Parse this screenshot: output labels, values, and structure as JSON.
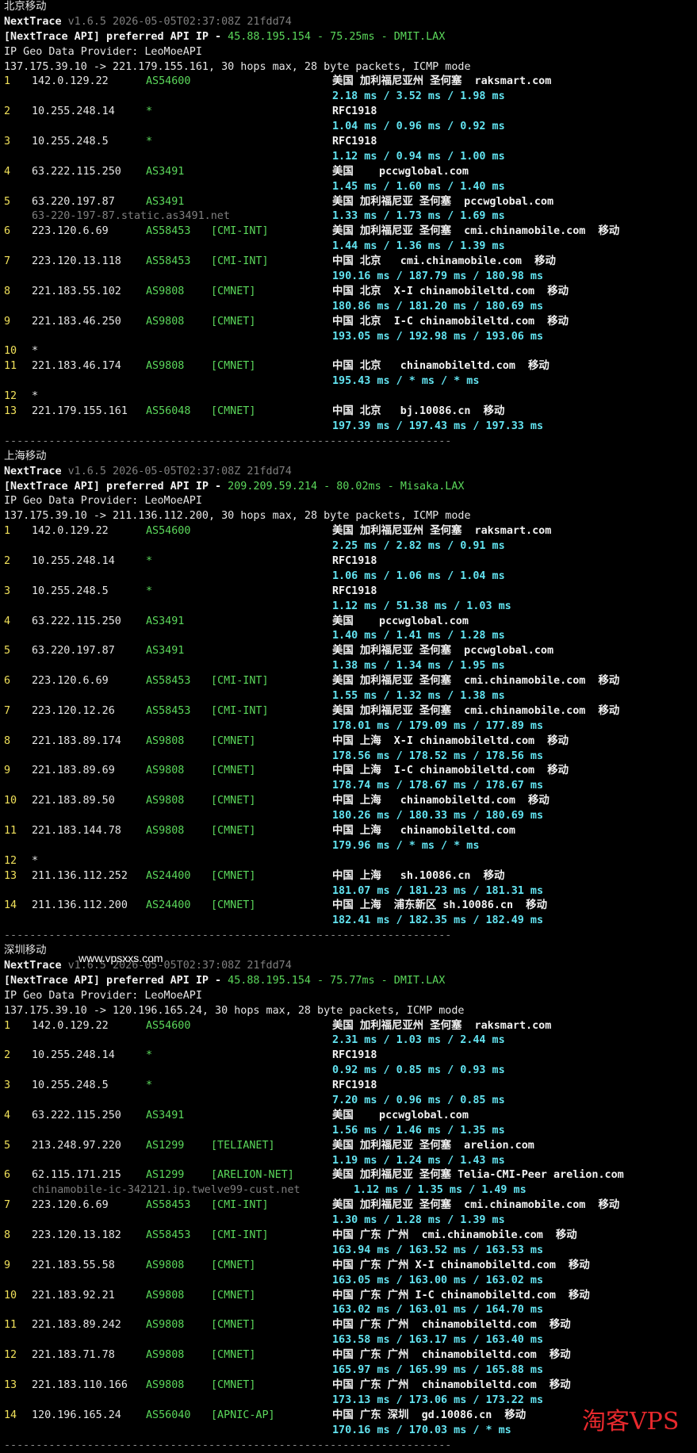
{
  "watermark_site": "www.vpsxxs.com",
  "watermark_logo": "淘客VPS",
  "separator": "----------------------------------------------------------------------",
  "sections": [
    {
      "title": "北京移动",
      "app": "NextTrace",
      "version": "v1.6.5 2026-05-05T02:37:08Z 21fdd74",
      "api_prefix": "[NextTrace API] preferred API IP - ",
      "api_ip": "45.88.195.154",
      "api_latency": "75.25ms",
      "api_node": "DMIT.LAX",
      "geo": "IP Geo Data Provider: LeoMoeAPI",
      "trace": "137.175.39.10 -> 221.179.155.161, 30 hops max, 28 byte packets, ICMP mode",
      "hops": [
        {
          "n": "1",
          "ip": "142.0.129.22",
          "as": "AS54600",
          "tag": "",
          "geo": "美国 加利福尼亚州 圣何塞  raksmart.com",
          "rtt": "2.18 ms / 3.52 ms / 1.98 ms"
        },
        {
          "n": "2",
          "ip": "10.255.248.14",
          "as": "*",
          "tag": "",
          "geo": "RFC1918",
          "rtt": "1.04 ms / 0.96 ms / 0.92 ms"
        },
        {
          "n": "3",
          "ip": "10.255.248.5",
          "as": "*",
          "tag": "",
          "geo": "RFC1918",
          "rtt": "1.12 ms / 0.94 ms / 1.00 ms"
        },
        {
          "n": "4",
          "ip": "63.222.115.250",
          "as": "AS3491",
          "tag": "",
          "geo": "美国    pccwglobal.com",
          "rtt": "1.45 ms / 1.60 ms / 1.40 ms"
        },
        {
          "n": "5",
          "ip": "63.220.197.87",
          "as": "AS3491",
          "tag": "",
          "geo": "美国 加利福尼亚 圣何塞  pccwglobal.com",
          "rtt": "1.33 ms / 1.73 ms / 1.69 ms",
          "rdns": "63-220-197-87.static.as3491.net"
        },
        {
          "n": "6",
          "ip": "223.120.6.69",
          "as": "AS58453",
          "tag": "[CMI-INT]",
          "geo": "美国 加利福尼亚 圣何塞  cmi.chinamobile.com  移动",
          "rtt": "1.44 ms / 1.36 ms / 1.39 ms"
        },
        {
          "n": "7",
          "ip": "223.120.13.118",
          "as": "AS58453",
          "tag": "[CMI-INT]",
          "geo": "中国 北京   cmi.chinamobile.com  移动",
          "rtt": "190.16 ms / 187.79 ms / 180.98 ms"
        },
        {
          "n": "8",
          "ip": "221.183.55.102",
          "as": "AS9808",
          "tag": "[CMNET]",
          "geo": "中国 北京  X-I chinamobileltd.com  移动",
          "rtt": "180.86 ms / 181.20 ms / 180.69 ms"
        },
        {
          "n": "9",
          "ip": "221.183.46.250",
          "as": "AS9808",
          "tag": "[CMNET]",
          "geo": "中国 北京  I-C chinamobileltd.com  移动",
          "rtt": "193.05 ms / 192.98 ms / 193.06 ms"
        },
        {
          "n": "10",
          "ip": "*"
        },
        {
          "n": "11",
          "ip": "221.183.46.174",
          "as": "AS9808",
          "tag": "[CMNET]",
          "geo": "中国 北京   chinamobileltd.com  移动",
          "rtt": "195.43 ms / * ms / * ms"
        },
        {
          "n": "12",
          "ip": "*"
        },
        {
          "n": "13",
          "ip": "221.179.155.161",
          "as": "AS56048",
          "tag": "[CMNET]",
          "geo": "中国 北京   bj.10086.cn  移动",
          "rtt": "197.39 ms / 197.43 ms / 197.33 ms"
        }
      ]
    },
    {
      "title": "上海移动",
      "app": "NextTrace",
      "version": "v1.6.5 2026-05-05T02:37:08Z 21fdd74",
      "api_prefix": "[NextTrace API] preferred API IP - ",
      "api_ip": "209.209.59.214",
      "api_latency": "80.02ms",
      "api_node": "Misaka.LAX",
      "geo": "IP Geo Data Provider: LeoMoeAPI",
      "trace": "137.175.39.10 -> 211.136.112.200, 30 hops max, 28 byte packets, ICMP mode",
      "hops": [
        {
          "n": "1",
          "ip": "142.0.129.22",
          "as": "AS54600",
          "tag": "",
          "geo": "美国 加利福尼亚州 圣何塞  raksmart.com",
          "rtt": "2.25 ms / 2.82 ms / 0.91 ms"
        },
        {
          "n": "2",
          "ip": "10.255.248.14",
          "as": "*",
          "tag": "",
          "geo": "RFC1918",
          "rtt": "1.06 ms / 1.06 ms / 1.04 ms"
        },
        {
          "n": "3",
          "ip": "10.255.248.5",
          "as": "*",
          "tag": "",
          "geo": "RFC1918",
          "rtt": "1.12 ms / 51.38 ms / 1.03 ms"
        },
        {
          "n": "4",
          "ip": "63.222.115.250",
          "as": "AS3491",
          "tag": "",
          "geo": "美国    pccwglobal.com",
          "rtt": "1.40 ms / 1.41 ms / 1.28 ms"
        },
        {
          "n": "5",
          "ip": "63.220.197.87",
          "as": "AS3491",
          "tag": "",
          "geo": "美国 加利福尼亚 圣何塞  pccwglobal.com",
          "rtt": "1.38 ms / 1.34 ms / 1.95 ms"
        },
        {
          "n": "6",
          "ip": "223.120.6.69",
          "as": "AS58453",
          "tag": "[CMI-INT]",
          "geo": "美国 加利福尼亚 圣何塞  cmi.chinamobile.com  移动",
          "rtt": "1.55 ms / 1.32 ms / 1.38 ms"
        },
        {
          "n": "7",
          "ip": "223.120.12.26",
          "as": "AS58453",
          "tag": "[CMI-INT]",
          "geo": "美国 加利福尼亚 圣何塞  cmi.chinamobile.com  移动",
          "rtt": "178.01 ms / 179.09 ms / 177.89 ms"
        },
        {
          "n": "8",
          "ip": "221.183.89.174",
          "as": "AS9808",
          "tag": "[CMNET]",
          "geo": "中国 上海  X-I chinamobileltd.com  移动",
          "rtt": "178.56 ms / 178.52 ms / 178.56 ms"
        },
        {
          "n": "9",
          "ip": "221.183.89.69",
          "as": "AS9808",
          "tag": "[CMNET]",
          "geo": "中国 上海  I-C chinamobileltd.com  移动",
          "rtt": "178.74 ms / 178.67 ms / 178.67 ms"
        },
        {
          "n": "10",
          "ip": "221.183.89.50",
          "as": "AS9808",
          "tag": "[CMNET]",
          "geo": "中国 上海   chinamobileltd.com  移动",
          "rtt": "180.26 ms / 180.33 ms / 180.69 ms"
        },
        {
          "n": "11",
          "ip": "221.183.144.78",
          "as": "AS9808",
          "tag": "[CMNET]",
          "geo": "中国 上海   chinamobileltd.com",
          "rtt": "179.96 ms / * ms / * ms"
        },
        {
          "n": "12",
          "ip": "*"
        },
        {
          "n": "13",
          "ip": "211.136.112.252",
          "as": "AS24400",
          "tag": "[CMNET]",
          "geo": "中国 上海   sh.10086.cn  移动",
          "rtt": "181.07 ms / 181.23 ms / 181.31 ms"
        },
        {
          "n": "14",
          "ip": "211.136.112.200",
          "as": "AS24400",
          "tag": "[CMNET]",
          "geo": "中国 上海  浦东新区 sh.10086.cn  移动",
          "rtt": "182.41 ms / 182.35 ms / 182.49 ms"
        }
      ]
    },
    {
      "title": "深圳移动",
      "app": "NextTrace",
      "version": "v1.6.5 2026-05-05T02:37:08Z 21fdd74",
      "api_prefix": "[NextTrace API] preferred API IP - ",
      "api_ip": "45.88.195.154",
      "api_latency": "75.77ms",
      "api_node": "DMIT.LAX",
      "geo": "IP Geo Data Provider: LeoMoeAPI",
      "trace": "137.175.39.10 -> 120.196.165.24, 30 hops max, 28 byte packets, ICMP mode",
      "hops": [
        {
          "n": "1",
          "ip": "142.0.129.22",
          "as": "AS54600",
          "tag": "",
          "geo": "美国 加利福尼亚州 圣何塞  raksmart.com",
          "rtt": "2.31 ms / 1.03 ms / 2.44 ms"
        },
        {
          "n": "2",
          "ip": "10.255.248.14",
          "as": "*",
          "tag": "",
          "geo": "RFC1918",
          "rtt": "0.92 ms / 0.85 ms / 0.93 ms"
        },
        {
          "n": "3",
          "ip": "10.255.248.5",
          "as": "*",
          "tag": "",
          "geo": "RFC1918",
          "rtt": "7.20 ms / 0.96 ms / 0.85 ms"
        },
        {
          "n": "4",
          "ip": "63.222.115.250",
          "as": "AS3491",
          "tag": "",
          "geo": "美国    pccwglobal.com",
          "rtt": "1.56 ms / 1.46 ms / 1.35 ms"
        },
        {
          "n": "5",
          "ip": "213.248.97.220",
          "as": "AS1299",
          "tag": "[TELIANET]",
          "geo": "美国 加利福尼亚 圣何塞  arelion.com",
          "rtt": "1.19 ms / 1.24 ms / 1.43 ms"
        },
        {
          "n": "6",
          "ip": "62.115.171.215",
          "as": "AS1299",
          "tag": "[ARELION-NET]",
          "geo": "美国 加利福尼亚 圣何塞 Telia-CMI-Peer arelion.com",
          "rtt": "1.12 ms / 1.35 ms / 1.49 ms",
          "rdns": "chinamobile-ic-342121.ip.twelve99-cust.net",
          "rtt_inline": true
        },
        {
          "n": "7",
          "ip": "223.120.6.69",
          "as": "AS58453",
          "tag": "[CMI-INT]",
          "geo": "美国 加利福尼亚 圣何塞  cmi.chinamobile.com  移动",
          "rtt": "1.30 ms / 1.28 ms / 1.39 ms"
        },
        {
          "n": "8",
          "ip": "223.120.13.182",
          "as": "AS58453",
          "tag": "[CMI-INT]",
          "geo": "中国 广东 广州  cmi.chinamobile.com  移动",
          "rtt": "163.94 ms / 163.52 ms / 163.53 ms"
        },
        {
          "n": "9",
          "ip": "221.183.55.58",
          "as": "AS9808",
          "tag": "[CMNET]",
          "geo": "中国 广东 广州 X-I chinamobileltd.com  移动",
          "rtt": "163.05 ms / 163.00 ms / 163.02 ms"
        },
        {
          "n": "10",
          "ip": "221.183.92.21",
          "as": "AS9808",
          "tag": "[CMNET]",
          "geo": "中国 广东 广州 I-C chinamobileltd.com  移动",
          "rtt": "163.02 ms / 163.01 ms / 164.70 ms"
        },
        {
          "n": "11",
          "ip": "221.183.89.242",
          "as": "AS9808",
          "tag": "[CMNET]",
          "geo": "中国 广东 广州  chinamobileltd.com  移动",
          "rtt": "163.58 ms / 163.17 ms / 163.40 ms"
        },
        {
          "n": "12",
          "ip": "221.183.71.78",
          "as": "AS9808",
          "tag": "[CMNET]",
          "geo": "中国 广东 广州  chinamobileltd.com  移动",
          "rtt": "165.97 ms / 165.99 ms / 165.88 ms"
        },
        {
          "n": "13",
          "ip": "221.183.110.166",
          "as": "AS9808",
          "tag": "[CMNET]",
          "geo": "中国 广东 广州  chinamobileltd.com  移动",
          "rtt": "173.13 ms / 173.06 ms / 173.22 ms"
        },
        {
          "n": "14",
          "ip": "120.196.165.24",
          "as": "AS56040",
          "tag": "[APNIC-AP]",
          "geo": "中国 广东 深圳  gd.10086.cn  移动",
          "rtt": "170.16 ms / 170.03 ms / * ms"
        }
      ]
    }
  ]
}
